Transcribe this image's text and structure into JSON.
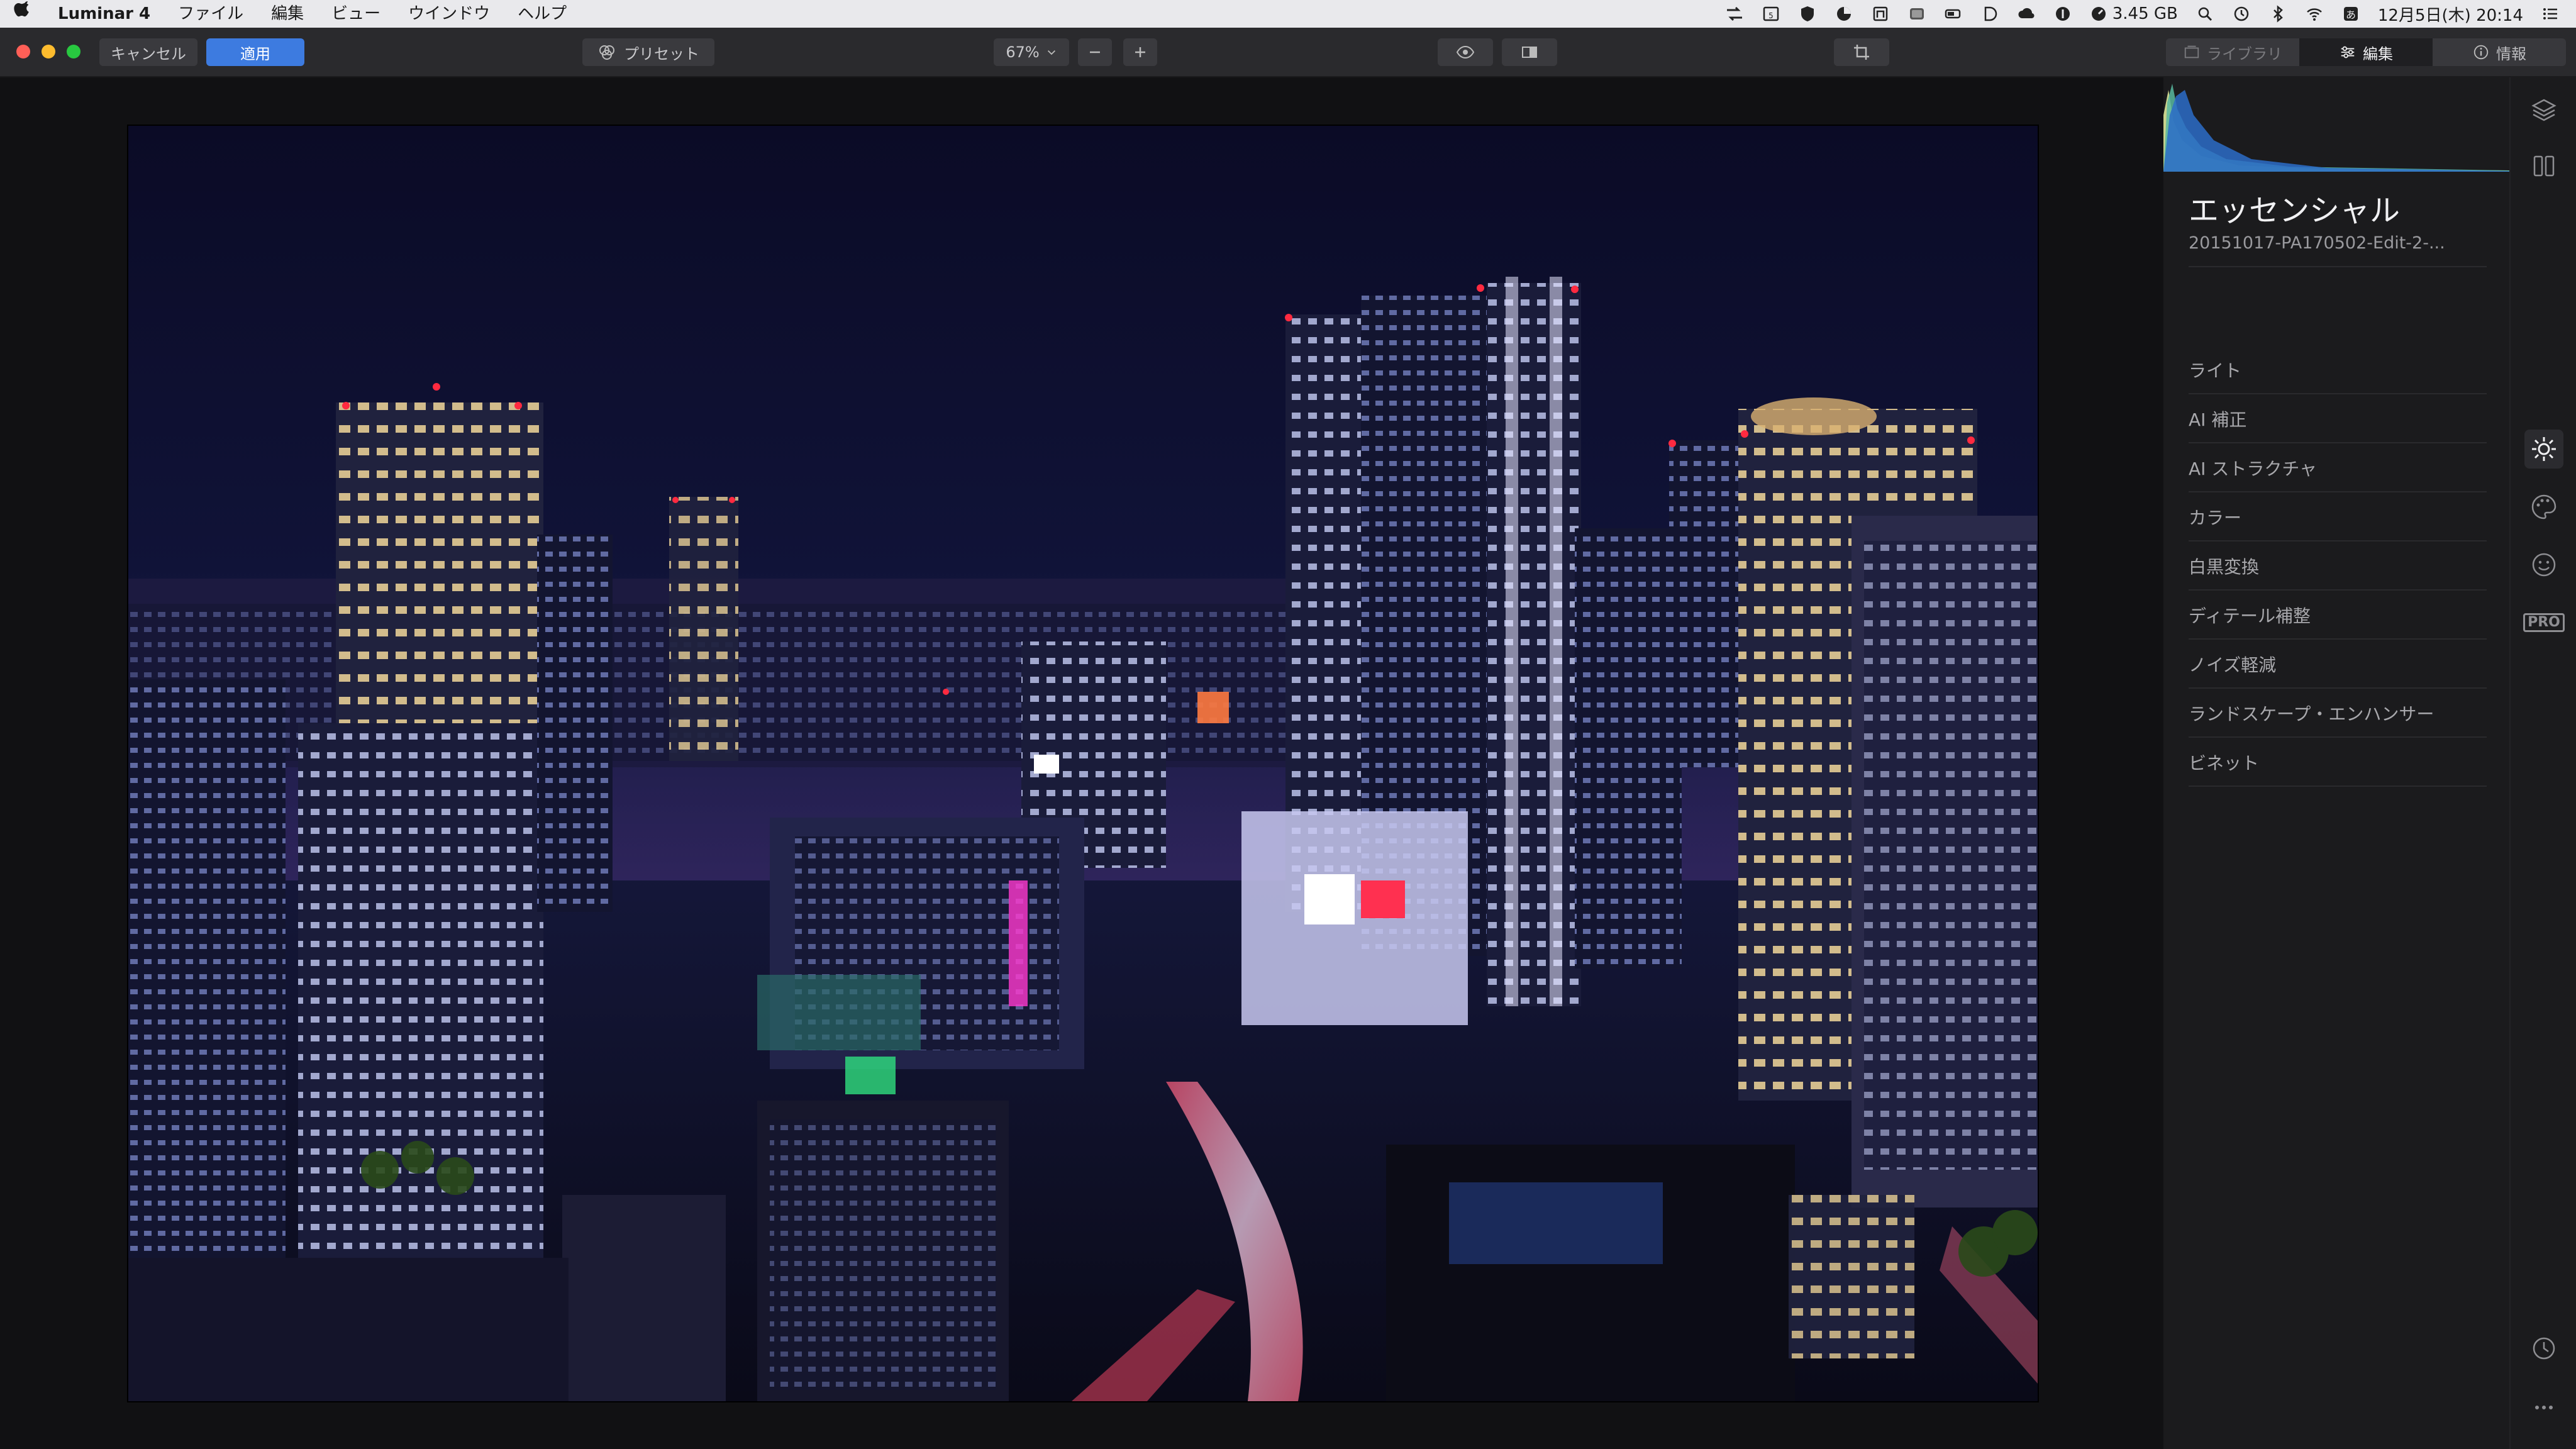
{
  "menubar": {
    "app_name": "Luminar 4",
    "items": [
      "ファイル",
      "編集",
      "ビュー",
      "ウインドウ",
      "ヘルプ"
    ],
    "memory": "3.45 GB",
    "datetime": "12月5日(木)  20:14"
  },
  "toolbar": {
    "cancel_label": "キャンセル",
    "apply_label": "適用",
    "presets_label": "プリセット",
    "zoom_value": "67%",
    "tabs": {
      "library": "ライブラリ",
      "edit": "編集",
      "info": "情報"
    }
  },
  "panel": {
    "title": "エッセンシャル",
    "filename": "20151017-PA170502-Edit-2-...",
    "tools": [
      "ライト",
      "AI 補正",
      "AI ストラクチャ",
      "カラー",
      "白黒変換",
      "ディテール補整",
      "ノイズ軽減",
      "ランドスケープ・エンハンサー",
      "ビネット"
    ]
  },
  "rail": {
    "icons": [
      "layers-icon",
      "canvas-icon",
      "essentials-sun-icon",
      "creative-palette-icon",
      "portrait-face-icon",
      "pro-badge",
      "history-clock-icon",
      "more-dots-icon"
    ],
    "pro_label": "PRO"
  },
  "colors": {
    "accent": "#3d7be0",
    "panel_bg": "#1b1b1d",
    "toolbar_bg": "#2a2a2d"
  }
}
